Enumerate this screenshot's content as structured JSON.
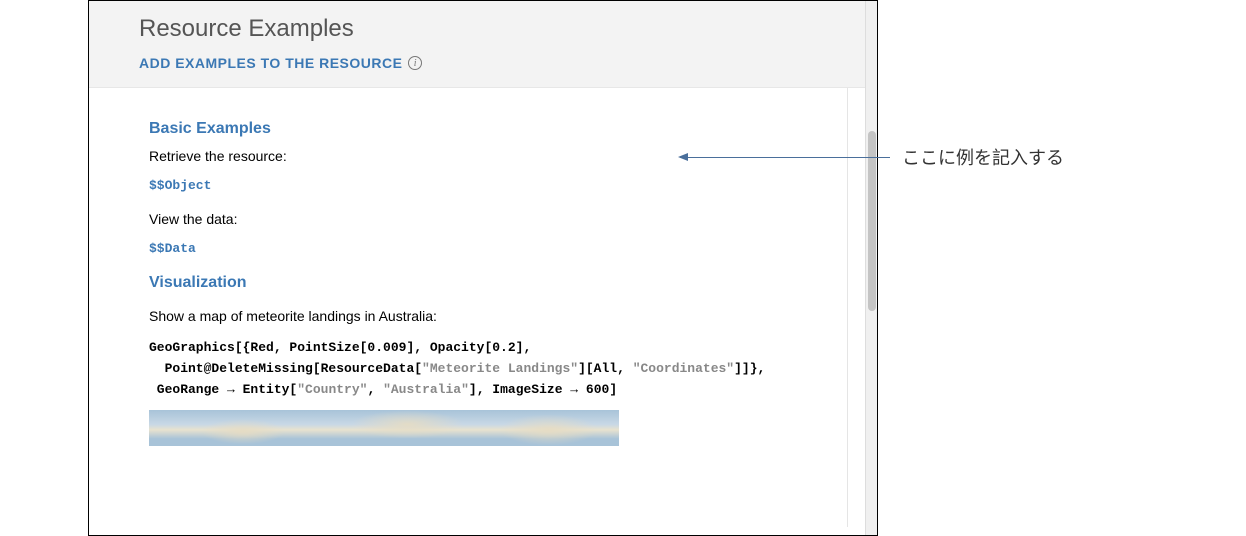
{
  "header": {
    "title": "Resource Examples",
    "subheader": "ADD EXAMPLES TO THE RESOURCE"
  },
  "sections": {
    "basic": {
      "heading": "Basic Examples",
      "retrieve_text": "Retrieve the resource:",
      "object_placeholder": "$$Object",
      "view_text": "View the data:",
      "data_placeholder": "$$Data"
    },
    "viz": {
      "heading": "Visualization",
      "intro": "Show a map of meteorite landings in Australia:",
      "code": {
        "line1_a": "GeoGraphics[{Red, PointSize[0.009], Opacity[0.2],",
        "line2_a": "  Point@DeleteMissing[ResourceData[",
        "line2_str1": "\"Meteorite Landings\"",
        "line2_b": "][All, ",
        "line2_str2": "\"Coordinates\"",
        "line2_c": "]]},",
        "line3_a": " GeoRange → Entity[",
        "line3_str1": "\"Country\"",
        "line3_b": ", ",
        "line3_str2": "\"Australia\"",
        "line3_c": "], ImageSize → 600]"
      }
    }
  },
  "callout": {
    "text": "ここに例を記入する"
  }
}
